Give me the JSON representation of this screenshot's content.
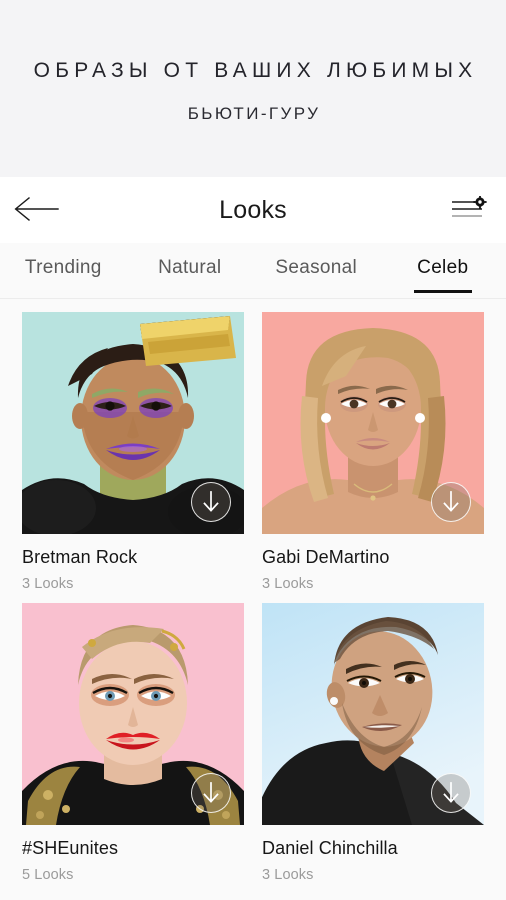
{
  "promo": {
    "line1": "ОБРАЗЫ ОТ ВАШИХ ЛЮБИМЫХ",
    "line2": "БЬЮТИ-ГУРУ"
  },
  "appbar": {
    "title": "Looks",
    "back_icon": "arrow-left-icon",
    "filter_icon": "filter-settings-icon"
  },
  "tabs": [
    {
      "label": "Trending",
      "active": false
    },
    {
      "label": "Natural",
      "active": false
    },
    {
      "label": "Seasonal",
      "active": false
    },
    {
      "label": "Celeb",
      "active": true
    }
  ],
  "cards": [
    {
      "title": "Bretman Rock",
      "looks": "3 Looks",
      "download_icon": "download-arrow-icon",
      "bg": "#b8e3df",
      "skin": "#c08a5e",
      "skin_shadow": "#a8714a",
      "hair": "#2b1d15",
      "accent": "#7a3fc0",
      "brow": "#8fa866",
      "garment": "#161616"
    },
    {
      "title": "Gabi DeMartino",
      "looks": "3 Looks",
      "download_icon": "download-arrow-icon",
      "bg": "#f8a8a0",
      "skin": "#d9a480",
      "skin_shadow": "#c08a64",
      "hair": "#c9a06a",
      "accent": "#c98a80",
      "brow": "#8a6a4c",
      "garment": "#d9a480"
    },
    {
      "title": "#SHEunites",
      "looks": "5 Looks",
      "download_icon": "download-arrow-icon",
      "bg": "#f9c0cf",
      "skin": "#f0cbb4",
      "skin_shadow": "#dfae93",
      "hair": "#b99a6d",
      "accent": "#e01f26",
      "brow": "#8a6240",
      "garment": "#141414"
    },
    {
      "title": "Daniel Chinchilla",
      "looks": "3 Looks",
      "download_icon": "download-arrow-icon",
      "bg": "#cfe8f5",
      "skin": "#cfa280",
      "skin_shadow": "#b4835f",
      "hair": "#5a4433",
      "accent": "#b07a58",
      "brow": "#43301f",
      "garment": "#1a1a1a"
    }
  ],
  "colors": {
    "page_bg": "#fafafa",
    "banner_bg": "#f4f4f6",
    "accent": "#111111",
    "muted_text": "#9b9b9b"
  }
}
